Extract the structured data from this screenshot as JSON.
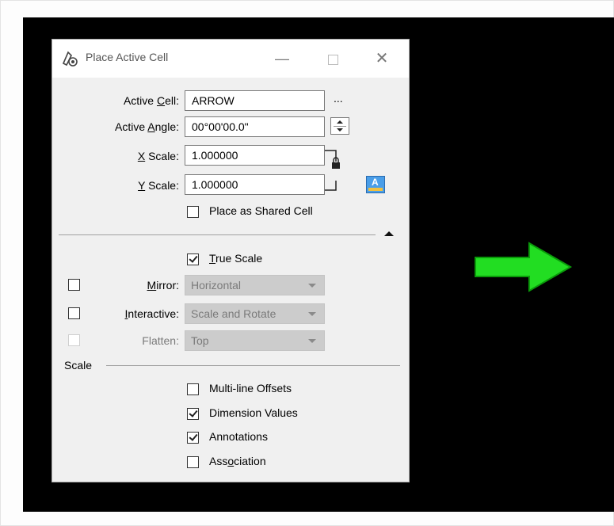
{
  "dialog": {
    "title": "Place Active Cell",
    "active_cell": {
      "label_pre": "Active ",
      "label_u": "C",
      "label_post": "ell:",
      "value": "ARROW",
      "browse": "..."
    },
    "active_angle": {
      "label_pre": "Active ",
      "label_u": "A",
      "label_post": "ngle:",
      "value": "00°00'00.0\""
    },
    "x_scale": {
      "label_u": "X",
      "label_post": " Scale:",
      "value": "1.000000"
    },
    "y_scale": {
      "label_u": "Y",
      "label_post": " Scale:",
      "value": "1.000000"
    },
    "place_shared": {
      "label": "Place as Shared Cell",
      "checked": false
    },
    "true_scale": {
      "label_u": "T",
      "label_post": "rue Scale",
      "checked": true
    },
    "mirror": {
      "label_u": "M",
      "label_post": "irror:",
      "value": "Horizontal",
      "checked": false
    },
    "interactive": {
      "label_u": "I",
      "label_post": "nteractive:",
      "value": "Scale and Rotate",
      "checked": false
    },
    "flatten": {
      "label": "Flatten:",
      "value": "Top",
      "checked": false
    },
    "scale_section": "Scale",
    "multi_line": {
      "label": "Multi-line Offsets",
      "checked": false
    },
    "dimension_values": {
      "label": "Dimension Values",
      "checked": true
    },
    "annotations": {
      "label": "Annotations",
      "checked": true
    },
    "association": {
      "label_pre": "Ass",
      "label_u": "o",
      "label_post": "ciation",
      "checked": false
    }
  },
  "colors": {
    "canvas": "#000000",
    "arrow": "#1ecf1e",
    "dialog_bg": "#f0f0f0"
  }
}
